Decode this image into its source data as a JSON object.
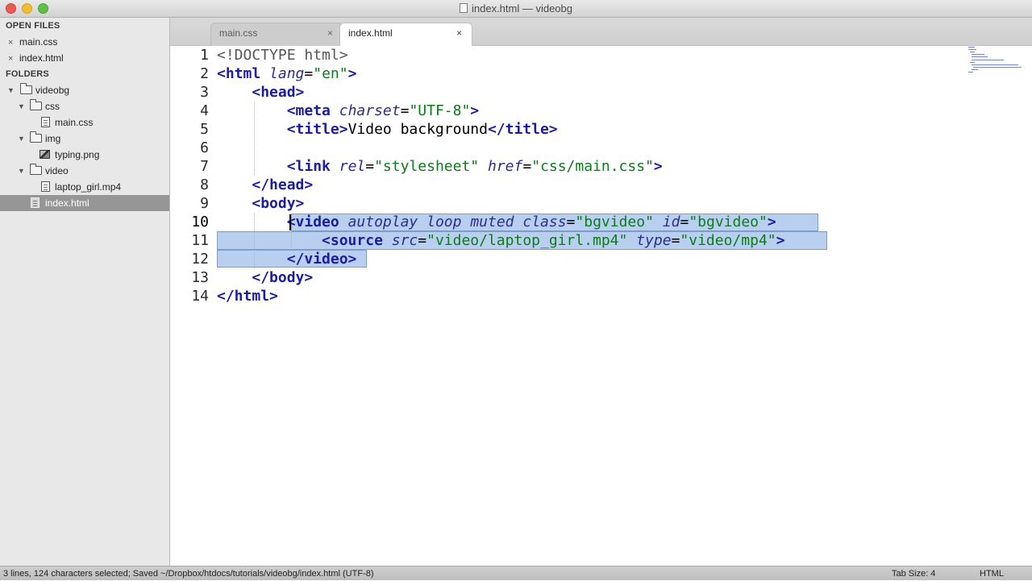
{
  "window": {
    "title": "index.html — videobg"
  },
  "sidebar": {
    "open_files_heading": "OPEN FILES",
    "open_files": [
      {
        "name": "main.css",
        "close": "×"
      },
      {
        "name": "index.html",
        "close": "×"
      }
    ],
    "folders_heading": "FOLDERS",
    "tree": [
      {
        "name": "videobg",
        "kind": "folder",
        "expanded": true
      },
      {
        "name": "css",
        "kind": "folder",
        "expanded": true
      },
      {
        "name": "main.css",
        "kind": "file"
      },
      {
        "name": "img",
        "kind": "folder",
        "expanded": true
      },
      {
        "name": "typing.png",
        "kind": "image"
      },
      {
        "name": "video",
        "kind": "folder",
        "expanded": true
      },
      {
        "name": "laptop_girl.mp4",
        "kind": "file"
      },
      {
        "name": "index.html",
        "kind": "file",
        "selected": true
      }
    ]
  },
  "tabs": [
    {
      "label": "main.css",
      "close": "×",
      "active": false
    },
    {
      "label": "index.html",
      "close": "×",
      "active": true
    }
  ],
  "editor": {
    "line_numbers": [
      "1",
      "2",
      "3",
      "4",
      "5",
      "6",
      "7",
      "8",
      "9",
      "10",
      "11",
      "12",
      "13",
      "14"
    ],
    "current_line": 10,
    "code": {
      "l1": {
        "decl": "<!DOCTYPE html>"
      },
      "l2": {
        "open": "<html",
        "attr_lang": "lang",
        "eq": "=",
        "val_lang": "\"en\"",
        "close": ">"
      },
      "l3": {
        "tag": "<head>"
      },
      "l4": {
        "open": "<meta",
        "attr_charset": "charset",
        "eq": "=",
        "val_charset": "\"UTF-8\"",
        "close": ">"
      },
      "l5": {
        "open": "<title>",
        "text": "Video background",
        "close": "</title>"
      },
      "l7": {
        "open": "<link",
        "attr_rel": "rel",
        "eq1": "=",
        "val_rel": "\"stylesheet\"",
        "attr_href": "href",
        "eq2": "=",
        "val_href": "\"css/main.css\"",
        "close": ">"
      },
      "l8": {
        "tag": "</head>"
      },
      "l9": {
        "tag": "<body>"
      },
      "l10": {
        "open": "<video",
        "attr1": "autoplay",
        "attr2": "loop",
        "attr3": "muted",
        "attr_class": "class",
        "eq1": "=",
        "val_class": "\"bgvideo\"",
        "attr_id": "id",
        "eq2": "=",
        "val_id": "\"bgvideo\"",
        "close": ">"
      },
      "l11": {
        "open": "<source",
        "attr_src": "src",
        "eq1": "=",
        "val_src": "\"video/laptop_girl.mp4\"",
        "attr_type": "type",
        "eq2": "=",
        "val_type": "\"video/mp4\"",
        "close": ">"
      },
      "l12": {
        "tag": "</video>"
      },
      "l13": {
        "tag": "</body>"
      },
      "l14": {
        "tag": "</html>"
      }
    }
  },
  "statusbar": {
    "left": "3 lines, 124 characters selected; Saved ~/Dropbox/htdocs/tutorials/videobg/index.html (UTF-8)",
    "tab_size": "Tab Size: 4",
    "syntax": "HTML"
  },
  "colors": {
    "tag": "#1c1c9e",
    "attribute": "#2c2c8f",
    "string": "#0e7a1b",
    "selection": "#b9cfef",
    "selected_sidebar_row": "#969696"
  }
}
